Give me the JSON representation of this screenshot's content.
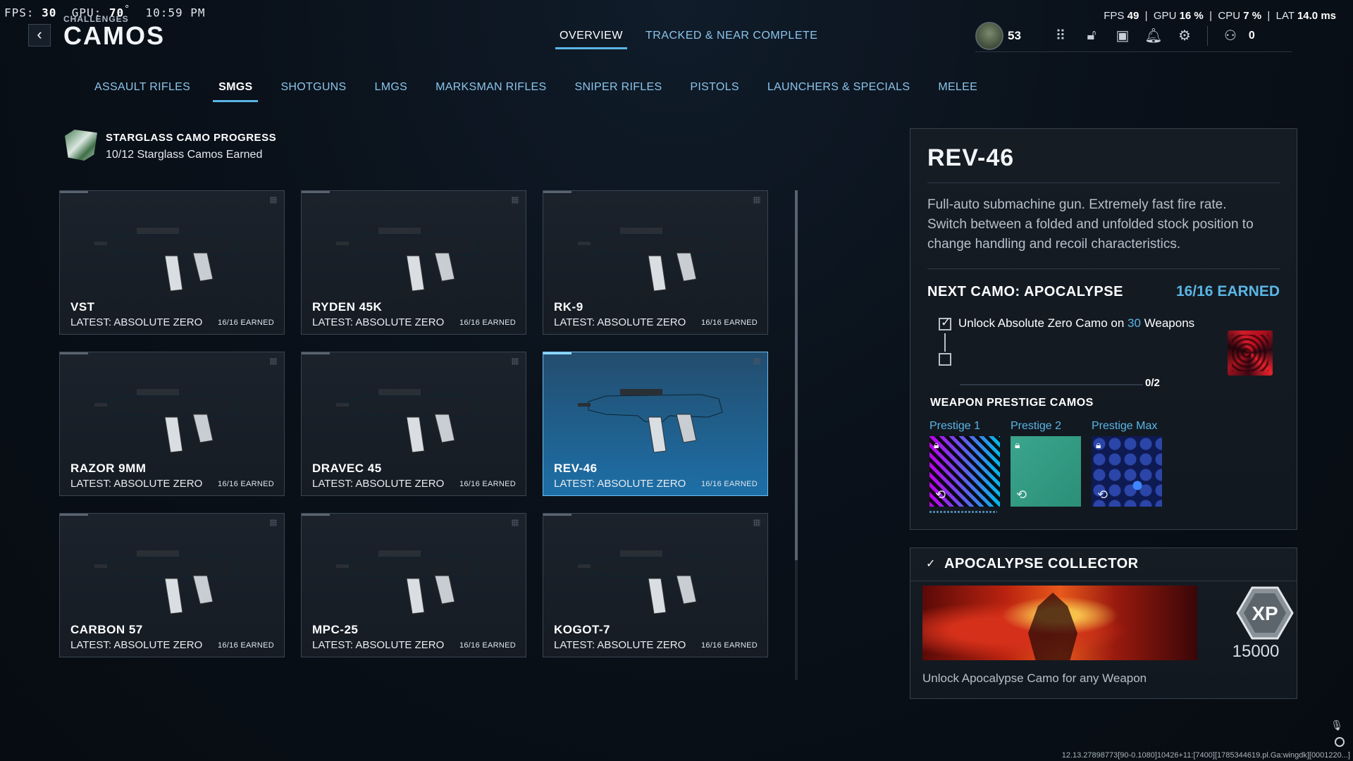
{
  "perf_left": {
    "fps_label": "FPS:",
    "fps": "30",
    "gpu_label": "GPU:",
    "gpu": "70",
    "deg": "°",
    "time": "10:59 PM"
  },
  "perf_right": {
    "fps_label": "FPS",
    "fps": "49",
    "gpu_label": "GPU",
    "gpu": "16 %",
    "cpu_label": "CPU",
    "cpu": "7 %",
    "lat_label": "LAT",
    "lat": "14.0 ms"
  },
  "header": {
    "breadcrumb": "CHALLENGES",
    "title": "CAMOS",
    "tabs": [
      {
        "label": "OVERVIEW"
      },
      {
        "label": "TRACKED & NEAR COMPLETE"
      }
    ],
    "level": "53",
    "party_count": "0"
  },
  "categories": [
    "ASSAULT RIFLES",
    "SMGS",
    "SHOTGUNS",
    "LMGS",
    "MARKSMAN RIFLES",
    "SNIPER RIFLES",
    "PISTOLS",
    "LAUNCHERS & SPECIALS",
    "MELEE"
  ],
  "active_category": "SMGS",
  "starglass": {
    "title": "STARGLASS CAMO PROGRESS",
    "subtitle": "10/12 Starglass Camos Earned"
  },
  "weapons": [
    {
      "name": "VST",
      "latest": "LATEST: ABSOLUTE ZERO",
      "earned": "16/16 EARNED"
    },
    {
      "name": "RYDEN 45K",
      "latest": "LATEST: ABSOLUTE ZERO",
      "earned": "16/16 EARNED"
    },
    {
      "name": "RK-9",
      "latest": "LATEST: ABSOLUTE ZERO",
      "earned": "16/16 EARNED"
    },
    {
      "name": "RAZOR 9MM",
      "latest": "LATEST: ABSOLUTE ZERO",
      "earned": "16/16 EARNED"
    },
    {
      "name": "DRAVEC 45",
      "latest": "LATEST: ABSOLUTE ZERO",
      "earned": "16/16 EARNED"
    },
    {
      "name": "REV-46",
      "latest": "LATEST: ABSOLUTE ZERO",
      "earned": "16/16 EARNED"
    },
    {
      "name": "CARBON 57",
      "latest": "LATEST: ABSOLUTE ZERO",
      "earned": "16/16 EARNED"
    },
    {
      "name": "MPC-25",
      "latest": "LATEST: ABSOLUTE ZERO",
      "earned": "16/16 EARNED"
    },
    {
      "name": "KOGOT-7",
      "latest": "LATEST: ABSOLUTE ZERO",
      "earned": "16/16 EARNED"
    }
  ],
  "detail": {
    "name": "REV-46",
    "description": "Full-auto submachine gun. Extremely fast fire rate. Switch between a folded and unfolded stock position to change handling and recoil characteristics.",
    "next_camo_label": "NEXT CAMO: APOCALYPSE",
    "next_camo_earned": "16/16 EARNED",
    "challenge_pre": "Unlock Absolute Zero Camo on ",
    "challenge_count": "30",
    "challenge_post": " Weapons",
    "progress": "0/2",
    "prestige_head": "WEAPON PRESTIGE CAMOS",
    "prestige": [
      {
        "label": "Prestige 1"
      },
      {
        "label": "Prestige 2"
      },
      {
        "label": "Prestige Max"
      }
    ]
  },
  "collector": {
    "title": "APOCALYPSE COLLECTOR",
    "xp_label": "XP",
    "xp": "15000",
    "description": "Unlock Apocalypse Camo for any Weapon"
  },
  "build_string": "12.13.27898773[90-0.1080]10426+11:[7400][1785344619.pl.Ga:wingdk][0001220...]",
  "colors": {
    "accent": "#5ab6e6",
    "selected_card": "#1d6fa7"
  }
}
